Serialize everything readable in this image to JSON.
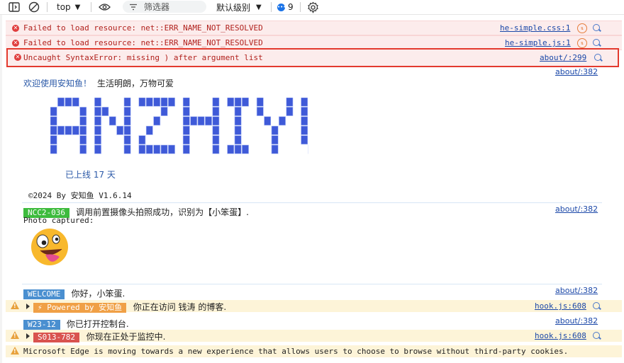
{
  "toolbar": {
    "context": "top",
    "filter_placeholder": "筛选器",
    "level": "默认级别",
    "issue_count": "9"
  },
  "messages": {
    "err1": {
      "text": "Failed to load resource: net::ERR_NAME_NOT_RESOLVED",
      "source": "he-simple.css:1"
    },
    "err2": {
      "text": "Failed to load resource: net::ERR_NAME_NOT_RESOLVED",
      "source": "he-simple.js:1"
    },
    "err3": {
      "text": "Uncaught SyntaxError: missing ) after argument list",
      "source": "about/:299"
    },
    "welcome_source": "about/:382",
    "welcome_blue": "欢迎使用安知鱼！",
    "welcome_text": "生活明朗，万物可爱",
    "ascii_art": "ANZHIYU",
    "online": "已上线 17 天",
    "copyright": "©2024 By 安知鱼 V1.6.14",
    "ncc_badge": "NCC2-036",
    "ncc_text": "调用前置摄像头拍照成功，识别为【小笨蛋】.",
    "ncc_source": "about/:382",
    "photo": "Photo captured:",
    "welcome_badge": "WELCOME",
    "welcome_msg": "你好，小笨蛋.",
    "welcome_msg_source": "about/:382",
    "powered_badge": "⚡ Powered by 安知鱼",
    "powered_text": "你正在访问 钱涛 的博客.",
    "powered_source": "hook.js:608",
    "w23_badge": "W23-12",
    "w23_text": "你已打开控制台.",
    "w23_source": "about/:382",
    "s013_badge": "S013-782",
    "s013_text": "你现在正处于监控中.",
    "s013_source": "hook.js:608",
    "edge_warn": "Microsoft Edge is moving towards a new experience that allows users to choose to browse without third-party cookies."
  },
  "colors": {
    "error_bg": "#fcecec",
    "warn_bg": "#fdf4d8",
    "ncc_badge": "#3dbb3d",
    "welcome_badge": "#4a8fd0",
    "powered_badge": "#f0a046",
    "s013_badge": "#d9534f",
    "ascii_blue": "#3f5ad8"
  }
}
